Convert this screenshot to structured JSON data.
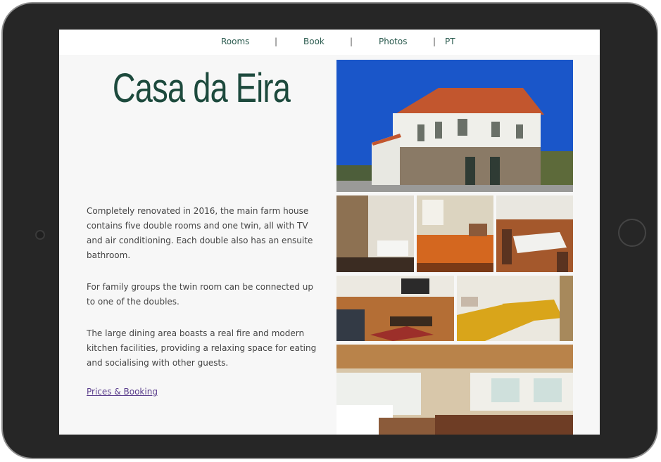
{
  "nav": {
    "items": [
      "Rooms",
      "Book",
      "Photos",
      "PT"
    ],
    "separator": "|"
  },
  "page": {
    "title": "Casa da Eira",
    "paragraphs": [
      "Completely renovated in 2016, the main farm house contains five double rooms and one twin, all with TV and air conditioning. Each double also has an ensuite bathroom.",
      "For family groups the twin room can be connected up to one of the doubles.",
      "The large dining area boasts a real fire and modern kitchen facilities, providing a relaxing space for eating and socialising with other guests."
    ],
    "link": "Prices & Booking"
  },
  "colors": {
    "title": "#1d4a3d",
    "nav_text": "#2a5a4e",
    "link": "#5a3e8c",
    "sky": "#1a56c9",
    "roof": "#c2562e"
  }
}
